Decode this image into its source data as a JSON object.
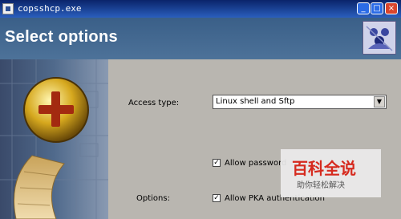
{
  "window": {
    "title": "copsshcp.exe",
    "min_glyph": "_",
    "max_glyph": "□",
    "close_glyph": "×"
  },
  "header": {
    "title": "Select options"
  },
  "form": {
    "access_type_label": "Access type:",
    "access_type_value": "Linux shell and Sftp",
    "dropdown_arrow": "▼",
    "allow_password_label": "Allow password",
    "allow_password_checked": true,
    "options_label": "Options:",
    "allow_pka_label": "Allow PKA authentication",
    "allow_pka_checked": true
  },
  "watermark": {
    "brand": "百科全说",
    "sub": "助你轻松解决"
  },
  "colors": {
    "header_bg": "#4a6f96",
    "title_bar": "#0a246a",
    "panel_bg": "#b9b6b0",
    "watermark_red": "#d62a1e"
  },
  "icons": {
    "app": "app-icon",
    "logo": "user-group-logo",
    "plus_ball": "plus-ball-icon"
  }
}
